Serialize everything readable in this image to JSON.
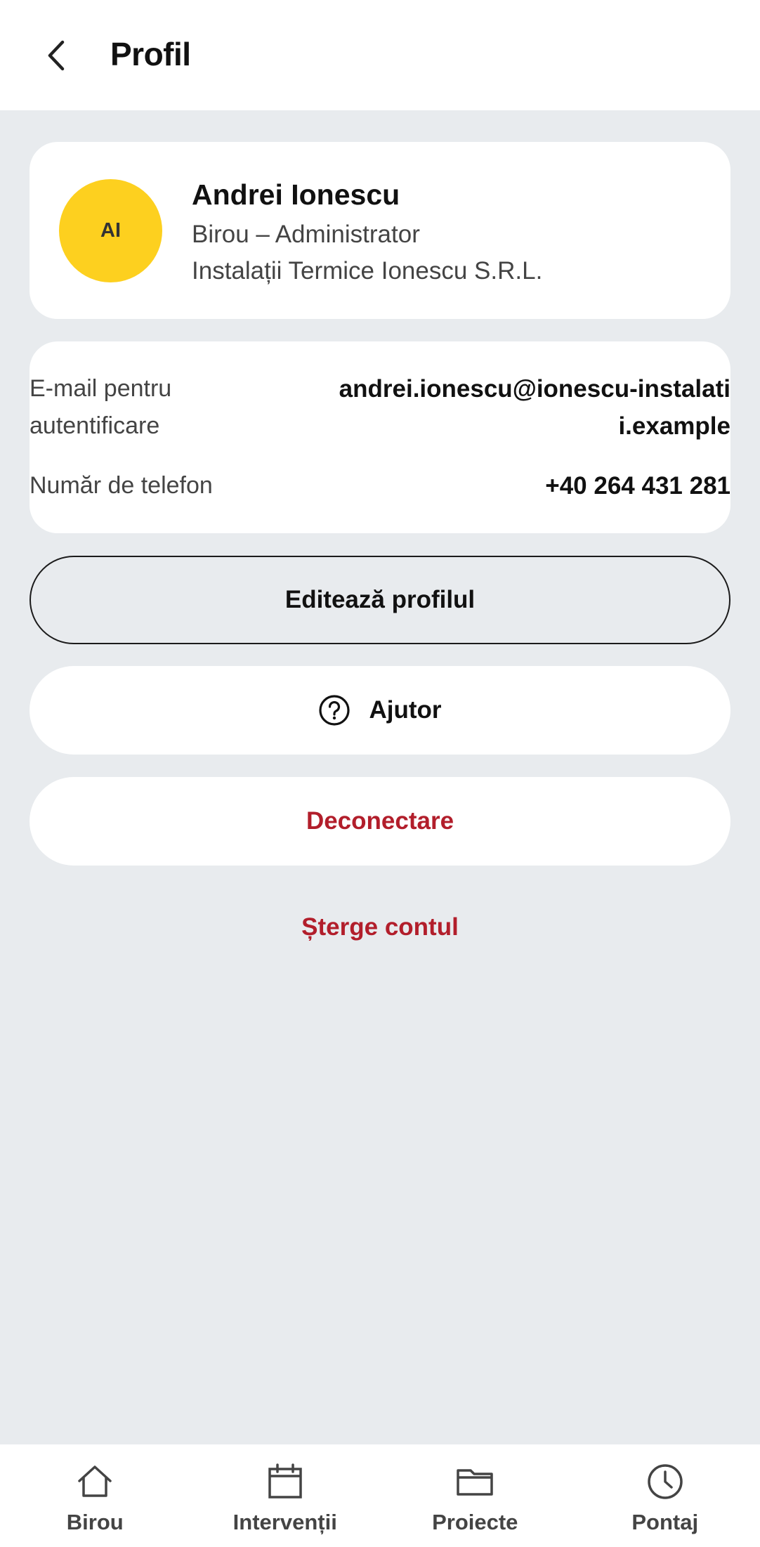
{
  "header": {
    "title": "Profil",
    "back_icon": "chevron-left-icon"
  },
  "profile": {
    "initials": "AI",
    "name": "Andrei Ionescu",
    "role": "Birou – Administrator",
    "company": "Instalații Termice Ionescu S.R.L.",
    "avatar_color": "#fdd01f"
  },
  "info": {
    "email_label": "E-mail pentru autentificare",
    "email_value": "andrei.ionescu@ionescu-instalatii.example",
    "phone_label": "Număr de telefon",
    "phone_value": "+40 264 431 281"
  },
  "actions": {
    "edit_label": "Editează profilul",
    "help_label": "Ajutor",
    "help_icon": "help-circle-icon",
    "logout_label": "Deconectare",
    "delete_label": "Șterge contul",
    "danger_color": "#b21e2b"
  },
  "nav": {
    "items": [
      {
        "label": "Birou",
        "icon": "home-icon"
      },
      {
        "label": "Intervenții",
        "icon": "calendar-icon"
      },
      {
        "label": "Proiecte",
        "icon": "folder-icon"
      },
      {
        "label": "Pontaj",
        "icon": "clock-icon"
      }
    ]
  }
}
